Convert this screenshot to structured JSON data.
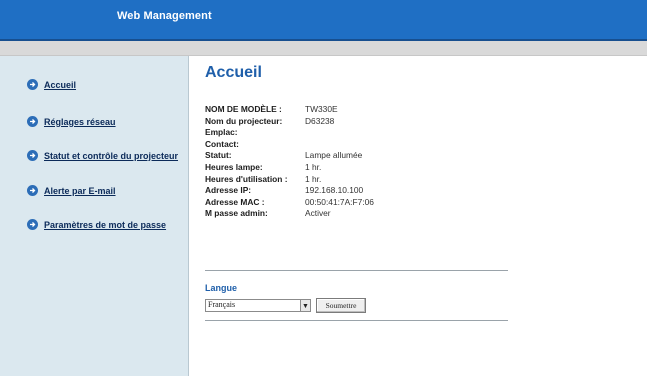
{
  "header": {
    "title": "Web Management"
  },
  "sidebar": {
    "items": [
      {
        "label": "Accueil",
        "icon": "arrow-right-circle-icon"
      },
      {
        "label": "Réglages réseau",
        "icon": "arrow-right-circle-icon"
      },
      {
        "label": "Statut et contrôle du projecteur",
        "icon": "arrow-right-circle-icon"
      },
      {
        "label": "Alerte par E-mail",
        "icon": "arrow-right-circle-icon"
      },
      {
        "label": "Paramètres de mot de passe",
        "icon": "arrow-right-circle-icon"
      }
    ]
  },
  "main": {
    "title": "Accueil",
    "info": [
      {
        "key": "NOM DE MODÈLE :",
        "value": "TW330E"
      },
      {
        "key": "Nom du projecteur:",
        "value": "D63238"
      },
      {
        "key": "Emplac:",
        "value": ""
      },
      {
        "key": "Contact:",
        "value": ""
      },
      {
        "key": "Statut:",
        "value": "Lampe allumée"
      },
      {
        "key": "Heures lampe:",
        "value": "1 hr."
      },
      {
        "key": "Heures d'utilisation :",
        "value": "1 hr."
      },
      {
        "key": "Adresse IP:",
        "value": "192.168.10.100"
      },
      {
        "key": "Adresse MAC :",
        "value": "00:50:41:7A:F7:06"
      },
      {
        "key": "M passe admin:",
        "value": "Activer"
      }
    ],
    "language": {
      "label": "Langue",
      "selected": "Français",
      "submit_label": "Soumettre"
    }
  },
  "colors": {
    "header": "#1f6fc4",
    "sidebar": "#dbe8ef",
    "title": "#1f5faa"
  }
}
